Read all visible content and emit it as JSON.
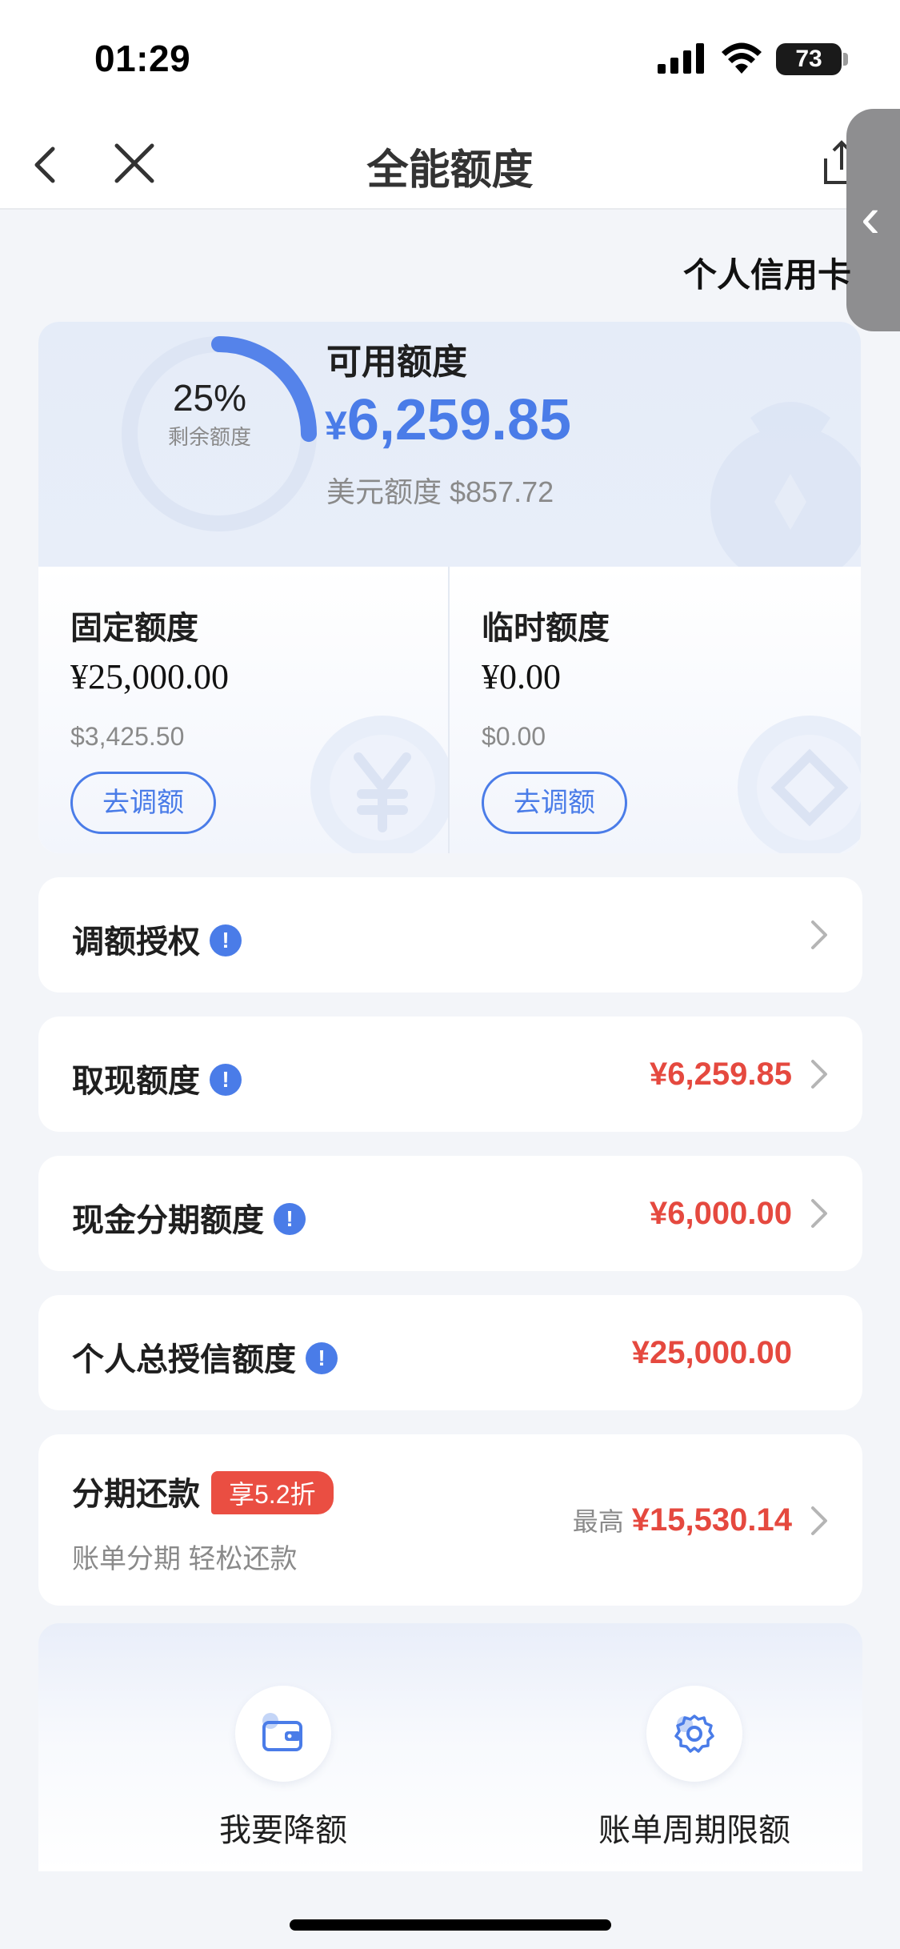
{
  "status_bar": {
    "time": "01:29",
    "battery": "73"
  },
  "nav": {
    "title": "全能额度"
  },
  "card_type": "个人信用卡",
  "summary": {
    "percent": "25%",
    "percent_label": "剩余额度",
    "remaining_fraction": 0.25,
    "available_label": "可用额度",
    "currency_symbol": "¥",
    "available_amount": "6,259.85",
    "usd_line": "美元额度 $857.72"
  },
  "fixed": {
    "title": "固定额度",
    "amount": "¥25,000.00",
    "usd": "$3,425.50",
    "button": "去调额"
  },
  "temporary": {
    "title": "临时额度",
    "amount": "¥0.00",
    "usd": "$0.00",
    "button": "去调额"
  },
  "rows": [
    {
      "label": "调额授权",
      "value": ""
    },
    {
      "label": "取现额度",
      "value": "¥6,259.85"
    },
    {
      "label": "现金分期额度",
      "value": "¥6,000.00"
    },
    {
      "label": "个人总授信额度",
      "value": "¥25,000.00"
    }
  ],
  "installment": {
    "label": "分期还款",
    "badge": "享5.2折",
    "subtitle": "账单分期 轻松还款",
    "prefix": "最高",
    "value": "¥15,530.14"
  },
  "actions": [
    {
      "label": "我要降额",
      "icon": "wallet-icon"
    },
    {
      "label": "账单周期限额",
      "icon": "gear-icon"
    }
  ],
  "colors": {
    "accent": "#4a7ce8",
    "amount_red": "#e5493f",
    "badge_red": "#ea4e42"
  }
}
